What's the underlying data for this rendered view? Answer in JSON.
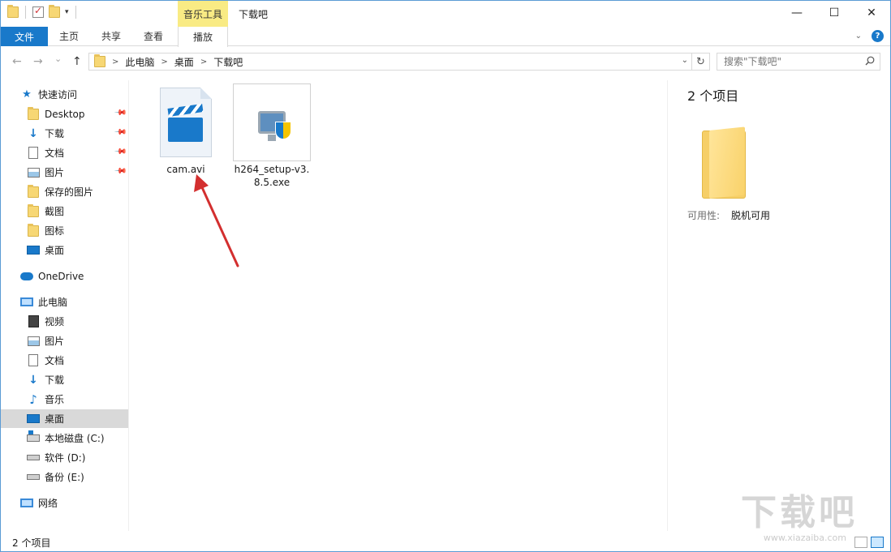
{
  "titlebar": {
    "contextual_group": "音乐工具",
    "window_title": "下载吧",
    "minimize": "—",
    "maximize": "☐",
    "close": "✕"
  },
  "ribbon": {
    "tabs": [
      "文件",
      "主页",
      "共享",
      "查看",
      "播放"
    ],
    "accent_color": "#1979ca",
    "contextual_color": "#f9eb84"
  },
  "navbar": {
    "back": "←",
    "forward": "→",
    "recent": "⌄",
    "up": "↑",
    "breadcrumbs": [
      "此电脑",
      "桌面",
      "下载吧"
    ],
    "search_placeholder": "搜索\"下载吧\""
  },
  "sidebar": {
    "quick_access": "快速访问",
    "quick_items": [
      {
        "label": "Desktop",
        "icon": "folder-icon",
        "pinned": true
      },
      {
        "label": "下载",
        "icon": "download-icon",
        "pinned": true
      },
      {
        "label": "文档",
        "icon": "document-icon",
        "pinned": true
      },
      {
        "label": "图片",
        "icon": "picture-icon",
        "pinned": true
      },
      {
        "label": "保存的图片",
        "icon": "folder-icon",
        "pinned": false
      },
      {
        "label": "截图",
        "icon": "folder-icon",
        "pinned": false
      },
      {
        "label": "图标",
        "icon": "folder-icon",
        "pinned": false
      },
      {
        "label": "桌面",
        "icon": "desktop-icon",
        "pinned": false
      }
    ],
    "onedrive": "OneDrive",
    "this_pc": "此电脑",
    "pc_items": [
      {
        "label": "视频",
        "icon": "video-icon"
      },
      {
        "label": "图片",
        "icon": "picture-icon"
      },
      {
        "label": "文档",
        "icon": "document-icon"
      },
      {
        "label": "下载",
        "icon": "download-icon"
      },
      {
        "label": "音乐",
        "icon": "music-icon"
      },
      {
        "label": "桌面",
        "icon": "desktop-icon",
        "selected": true
      },
      {
        "label": "本地磁盘 (C:)",
        "icon": "system-drive-icon"
      },
      {
        "label": "软件 (D:)",
        "icon": "drive-icon"
      },
      {
        "label": "备份 (E:)",
        "icon": "drive-icon"
      }
    ],
    "network": "网络"
  },
  "files": [
    {
      "name": "cam.avi",
      "icon": "video-file-icon",
      "selected": false
    },
    {
      "name": "h264_setup-v3.8.5.exe",
      "icon": "installer-icon",
      "selected": false
    }
  ],
  "details": {
    "count": "2 个项目",
    "availability_label": "可用性:",
    "availability_value": "脱机可用"
  },
  "statusbar": {
    "count": "2 个项目"
  },
  "watermark": {
    "text": "下载吧",
    "url": "www.xiazaiba.com"
  },
  "annotation": {
    "arrow_color": "#d32f2f"
  }
}
